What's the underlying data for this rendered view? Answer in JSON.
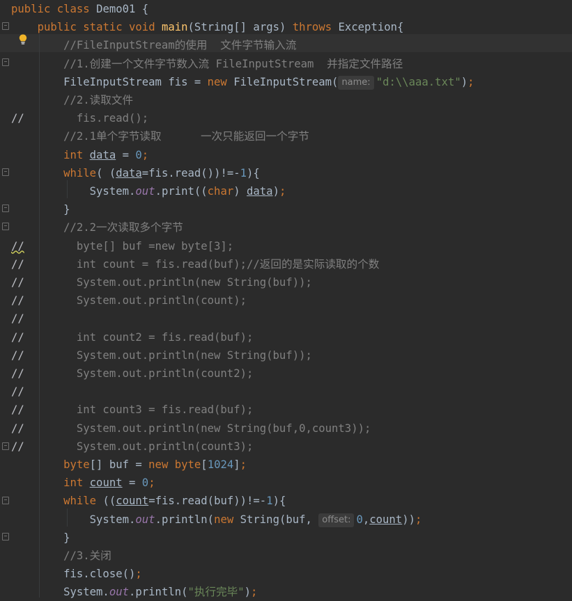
{
  "lines": [
    {
      "lead": "",
      "code": "public class Demo01 {"
    },
    {
      "lead": "",
      "code": "    public static void main(String[] args) throws Exception{"
    },
    {
      "lead": "",
      "code": "        //FileInputStream的使用  文件字节输入流"
    },
    {
      "lead": "",
      "code": "        //1.创建一个文件字节数入流 FileInputStream  并指定文件路径"
    },
    {
      "lead": "",
      "code": "        FileInputStream fis = new FileInputStream(name: \"d:\\\\aaa.txt\");"
    },
    {
      "lead": "",
      "code": "        //2.读取文件"
    },
    {
      "lead": "//",
      "code": "          fis.read();"
    },
    {
      "lead": "",
      "code": "        //2.1单个字节读取      一次只能返回一个字节"
    },
    {
      "lead": "",
      "code": "        int data = 0;"
    },
    {
      "lead": "",
      "code": "        while( (data=fis.read())!=-1){"
    },
    {
      "lead": "",
      "code": "            System.out.print((char) data);"
    },
    {
      "lead": "",
      "code": "        }"
    },
    {
      "lead": "",
      "code": "        //2.2一次读取多个字节"
    },
    {
      "lead": "//",
      "code": "          byte[] buf =new byte[3];"
    },
    {
      "lead": "//",
      "code": "          int count = fis.read(buf);//返回的是实际读取的个数"
    },
    {
      "lead": "//",
      "code": "          System.out.println(new String(buf));"
    },
    {
      "lead": "//",
      "code": "          System.out.println(count);"
    },
    {
      "lead": "//",
      "code": ""
    },
    {
      "lead": "//",
      "code": "          int count2 = fis.read(buf);"
    },
    {
      "lead": "//",
      "code": "          System.out.println(new String(buf));"
    },
    {
      "lead": "//",
      "code": "          System.out.println(count2);"
    },
    {
      "lead": "//",
      "code": ""
    },
    {
      "lead": "//",
      "code": "          int count3 = fis.read(buf);"
    },
    {
      "lead": "//",
      "code": "          System.out.println(new String(buf,0,count3));"
    },
    {
      "lead": "//",
      "code": "          System.out.println(count3);"
    },
    {
      "lead": "",
      "code": "        byte[] buf = new byte[1024];"
    },
    {
      "lead": "",
      "code": "        int count = 0;"
    },
    {
      "lead": "",
      "code": "        while ((count=fis.read(buf))!=-1){"
    },
    {
      "lead": "",
      "code": "            System.out.println(new String(buf, offset: 0,count));"
    },
    {
      "lead": "",
      "code": "        }"
    },
    {
      "lead": "",
      "code": "        //3.关闭"
    },
    {
      "lead": "",
      "code": "        fis.close();"
    },
    {
      "lead": "",
      "code": "        System.out.println(\"执行完毕\");"
    }
  ],
  "hints": {
    "name": "name:",
    "offset": "offset:"
  },
  "icons": {
    "intention_bulb": "lightbulb-icon",
    "fold_marker": "fold-icon"
  },
  "colors": {
    "background": "#2b2b2b",
    "keyword": "#cc7832",
    "comment": "#808080",
    "string": "#6a8759",
    "number": "#6897bb",
    "method": "#ffc66d",
    "static_field": "#9876aa",
    "text": "#a9b7c6"
  }
}
